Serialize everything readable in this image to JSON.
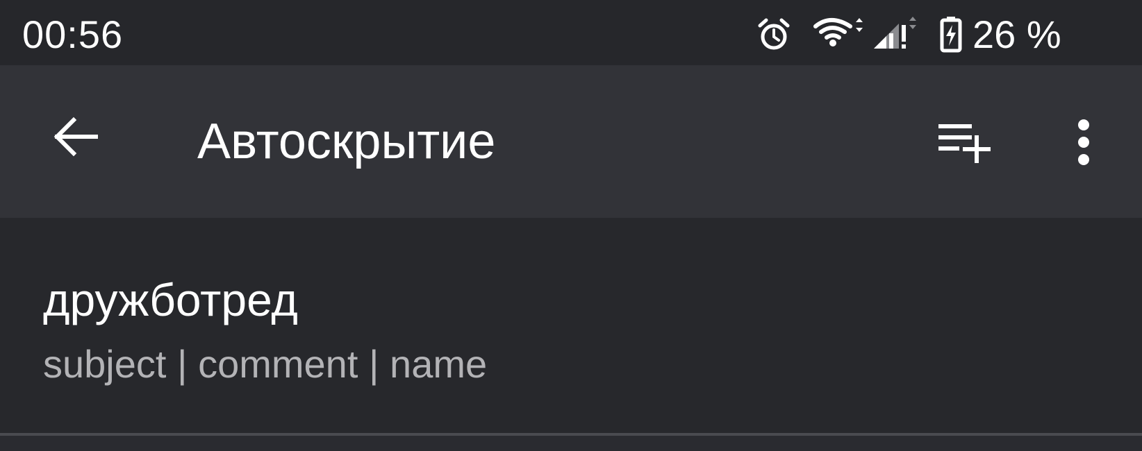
{
  "status_bar": {
    "time": "00:56",
    "battery_percent": "26 %",
    "icons": [
      "alarm-icon",
      "wifi-icon",
      "cellular-signal-icon",
      "battery-charging-icon"
    ]
  },
  "toolbar": {
    "title": "Автоскрытие",
    "back_icon": "arrow-left-icon",
    "add_icon": "playlist-add-icon",
    "more_icon": "more-vertical-icon"
  },
  "list": {
    "items": [
      {
        "title": "дружботред",
        "subtitle": "subject | comment | name"
      }
    ]
  },
  "colors": {
    "background": "#27282c",
    "status_bar": "#26272b",
    "toolbar": "#323338",
    "primary_text": "#ffffff",
    "secondary_text": "#b3b3b6",
    "divider": "#4a4b50"
  }
}
